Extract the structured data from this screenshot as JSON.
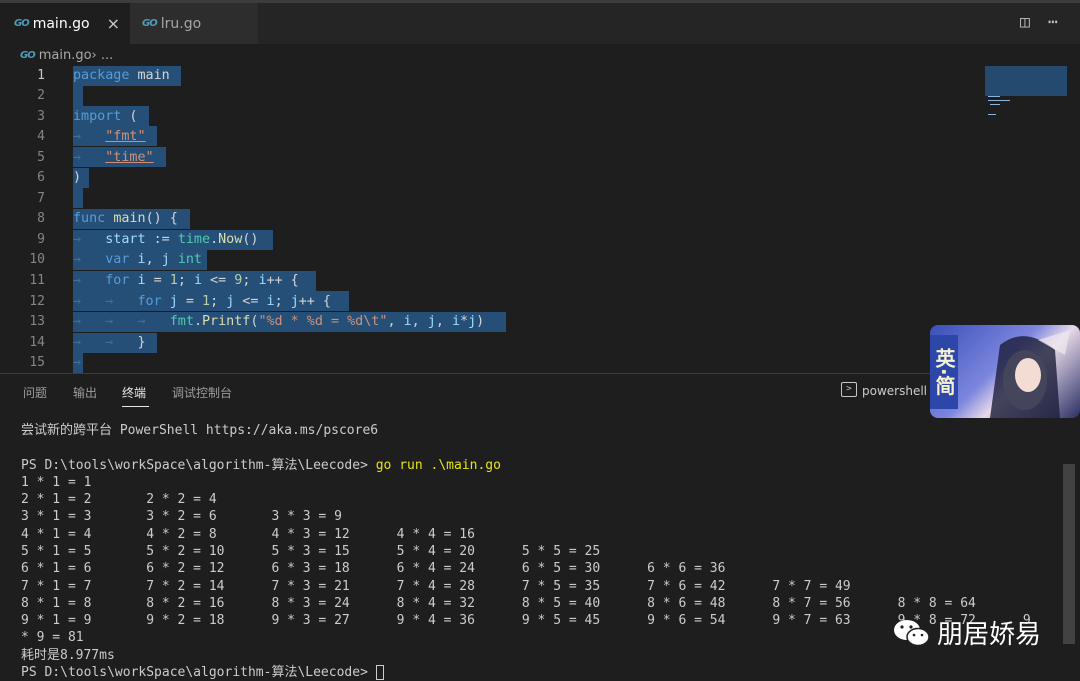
{
  "tabs": [
    {
      "icon": "go-file-icon",
      "label": "main.go",
      "active": true
    },
    {
      "icon": "go-file-icon",
      "label": "lru.go",
      "active": false
    }
  ],
  "icons": {
    "go": "GO",
    "close": "×",
    "split": "◫",
    "more": "⋯"
  },
  "breadcrumb": {
    "file": "main.go",
    "sep": " › ..."
  },
  "editor": {
    "line_numbers": [
      "1",
      "2",
      "3",
      "4",
      "5",
      "6",
      "7",
      "8",
      "9",
      "10",
      "11",
      "12",
      "13",
      "14",
      "15"
    ]
  },
  "panel": {
    "tabs": [
      "问题",
      "输出",
      "终端",
      "调试控制台"
    ],
    "active_tab": "终端",
    "shell": "powershell"
  },
  "terminal": {
    "lines": [
      "尝试新的跨平台 PowerShell https://aka.ms/pscore6",
      "",
      "PS D:\\tools\\workSpace\\algorithm-算法\\Leecode>",
      "1 * 1 = 1",
      "2 * 1 = 2       2 * 2 = 4",
      "3 * 1 = 3       3 * 2 = 6       3 * 3 = 9",
      "4 * 1 = 4       4 * 2 = 8       4 * 3 = 12      4 * 4 = 16",
      "5 * 1 = 5       5 * 2 = 10      5 * 3 = 15      5 * 4 = 20      5 * 5 = 25",
      "6 * 1 = 6       6 * 2 = 12      6 * 3 = 18      6 * 4 = 24      6 * 5 = 30      6 * 6 = 36",
      "7 * 1 = 7       7 * 2 = 14      7 * 3 = 21      7 * 4 = 28      7 * 5 = 35      7 * 6 = 42      7 * 7 = 49",
      "8 * 1 = 8       8 * 2 = 16      8 * 3 = 24      8 * 4 = 32      8 * 5 = 40      8 * 6 = 48      8 * 7 = 56      8 * 8 = 64",
      "9 * 1 = 9       9 * 2 = 18      9 * 3 = 27      9 * 4 = 36      9 * 5 = 45      9 * 6 = 54      9 * 7 = 63      9 * 8 = 72      9",
      "* 9 = 81",
      "耗时是8.977ms",
      "PS D:\\tools\\workSpace\\algorithm-算法\\Leecode> "
    ],
    "command": " go run .\\main.go"
  },
  "overlay": {
    "badge": "英·简",
    "watermark": "朋居娇易"
  },
  "colors": {
    "editor_bg": "#1e1e1e",
    "selection": "#264f78",
    "keyword": "#569cd6",
    "string": "#ce9178",
    "function": "#dcdcaa"
  }
}
